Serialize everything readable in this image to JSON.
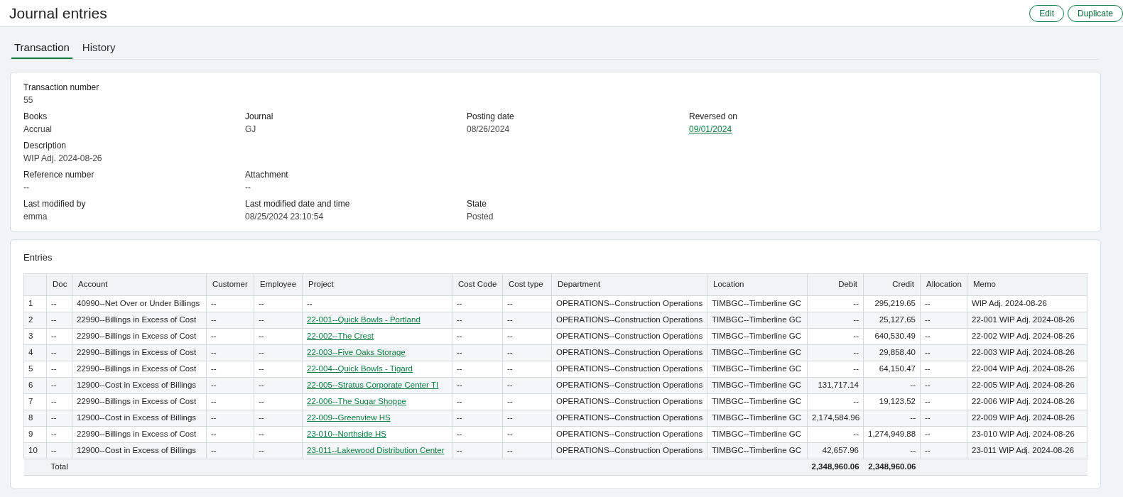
{
  "page": {
    "title": "Journal entries",
    "actions": [
      "Edit",
      "Duplicate"
    ]
  },
  "tabs": [
    {
      "label": "Transaction",
      "selected": true
    },
    {
      "label": "History",
      "selected": false
    }
  ],
  "details": [
    [
      {
        "label": "Transaction number",
        "value": "55",
        "kind": "text"
      }
    ],
    [
      {
        "label": "Books",
        "value": "Accrual",
        "kind": "text"
      },
      {
        "label": "Journal",
        "value": "GJ",
        "kind": "text"
      },
      {
        "label": "Posting date",
        "value": "08/26/2024",
        "kind": "text"
      },
      {
        "label": "Reversed on",
        "value": "09/01/2024",
        "kind": "link"
      }
    ],
    [
      {
        "label": "Description",
        "value": "WIP Adj. 2024-08-26",
        "kind": "text"
      }
    ],
    [
      {
        "label": "Reference number",
        "value": "--",
        "kind": "text"
      },
      {
        "label": "Attachment",
        "value": "--",
        "kind": "text"
      }
    ],
    [
      {
        "label": "Last modified by",
        "value": "emma",
        "kind": "text"
      },
      {
        "label": "Last modified date and time",
        "value": "08/25/2024 23:10:54",
        "kind": "text"
      },
      {
        "label": "State",
        "value": "Posted",
        "kind": "text"
      }
    ]
  ],
  "entries": {
    "title": "Entries",
    "columns": [
      {
        "kind": "index"
      },
      {
        "label": "Doc",
        "kind": "text"
      },
      {
        "label": "Account",
        "kind": "text"
      },
      {
        "label": "Customer",
        "kind": "text"
      },
      {
        "label": "Employee",
        "kind": "text"
      },
      {
        "label": "Project",
        "kind": "project"
      },
      {
        "label": "Cost Code",
        "kind": "text"
      },
      {
        "label": "Cost type",
        "kind": "text"
      },
      {
        "label": "Department",
        "kind": "text"
      },
      {
        "label": "Location",
        "kind": "text"
      },
      {
        "label": "Debit",
        "kind": "number"
      },
      {
        "label": "Credit",
        "kind": "number"
      },
      {
        "label": "Allocation",
        "kind": "text"
      },
      {
        "label": "Memo",
        "kind": "text"
      }
    ],
    "rows": [
      {
        "project_link": false,
        "cells": [
          "1",
          "--",
          "40990--Net Over or Under Billings",
          "--",
          "--",
          "--",
          "--",
          "--",
          "OPERATIONS--Construction Operations",
          "TIMBGC--Timberline GC",
          "--",
          "295,219.65",
          "--",
          "WIP Adj. 2024-08-26"
        ]
      },
      {
        "project_link": true,
        "cells": [
          "2",
          "--",
          "22990--Billings in Excess of Cost",
          "--",
          "--",
          "22-001--Quick Bowls - Portland",
          "--",
          "--",
          "OPERATIONS--Construction Operations",
          "TIMBGC--Timberline GC",
          "--",
          "25,127.65",
          "--",
          "22-001 WIP Adj. 2024-08-26"
        ]
      },
      {
        "project_link": true,
        "cells": [
          "3",
          "--",
          "22990--Billings in Excess of Cost",
          "--",
          "--",
          "22-002--The Crest",
          "--",
          "--",
          "OPERATIONS--Construction Operations",
          "TIMBGC--Timberline GC",
          "--",
          "640,530.49",
          "--",
          "22-002 WIP Adj. 2024-08-26"
        ]
      },
      {
        "project_link": true,
        "cells": [
          "4",
          "--",
          "22990--Billings in Excess of Cost",
          "--",
          "--",
          "22-003--Five Oaks Storage",
          "--",
          "--",
          "OPERATIONS--Construction Operations",
          "TIMBGC--Timberline GC",
          "--",
          "29,858.40",
          "--",
          "22-003 WIP Adj. 2024-08-26"
        ]
      },
      {
        "project_link": true,
        "cells": [
          "5",
          "--",
          "22990--Billings in Excess of Cost",
          "--",
          "--",
          "22-004--Quick Bowls - Tigard",
          "--",
          "--",
          "OPERATIONS--Construction Operations",
          "TIMBGC--Timberline GC",
          "--",
          "64,150.47",
          "--",
          "22-004 WIP Adj. 2024-08-26"
        ]
      },
      {
        "project_link": true,
        "cells": [
          "6",
          "--",
          "12900--Cost in Excess of Billings",
          "--",
          "--",
          "22-005--Stratus Corporate Center TI",
          "--",
          "--",
          "OPERATIONS--Construction Operations",
          "TIMBGC--Timberline GC",
          "131,717.14",
          "--",
          "--",
          "22-005 WIP Adj. 2024-08-26"
        ]
      },
      {
        "project_link": true,
        "cells": [
          "7",
          "--",
          "22990--Billings in Excess of Cost",
          "--",
          "--",
          "22-006--The Sugar Shoppe",
          "--",
          "--",
          "OPERATIONS--Construction Operations",
          "TIMBGC--Timberline GC",
          "--",
          "19,123.52",
          "--",
          "22-006 WIP Adj. 2024-08-26"
        ]
      },
      {
        "project_link": true,
        "cells": [
          "8",
          "--",
          "12900--Cost in Excess of Billings",
          "--",
          "--",
          "22-009--Greenview HS",
          "--",
          "--",
          "OPERATIONS--Construction Operations",
          "TIMBGC--Timberline GC",
          "2,174,584.96",
          "--",
          "--",
          "22-009 WIP Adj. 2024-08-26"
        ]
      },
      {
        "project_link": true,
        "cells": [
          "9",
          "--",
          "22990--Billings in Excess of Cost",
          "--",
          "--",
          "23-010--Northside HS",
          "--",
          "--",
          "OPERATIONS--Construction Operations",
          "TIMBGC--Timberline GC",
          "--",
          "1,274,949.88",
          "--",
          "23-010 WIP Adj. 2024-08-26"
        ]
      },
      {
        "project_link": true,
        "cells": [
          "10",
          "--",
          "12900--Cost in Excess of Billings",
          "--",
          "--",
          "23-011--Lakewood Distribution Center",
          "--",
          "--",
          "OPERATIONS--Construction Operations",
          "TIMBGC--Timberline GC",
          "42,657.96",
          "--",
          "--",
          "23-011 WIP Adj. 2024-08-26"
        ]
      }
    ],
    "total": {
      "label": "Total",
      "debit": "2,348,960.06",
      "credit": "2,348,960.06"
    }
  }
}
